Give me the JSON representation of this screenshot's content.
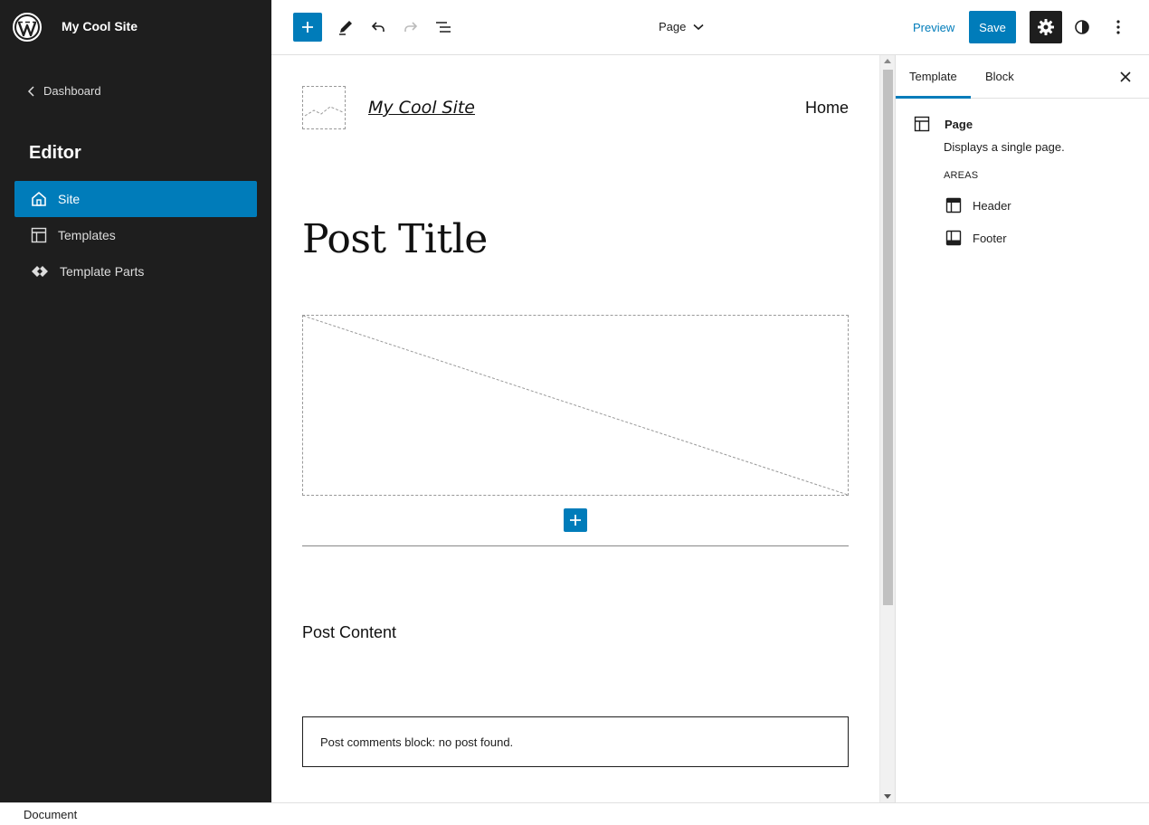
{
  "sidebar": {
    "site_name": "My Cool Site",
    "dashboard_label": "Dashboard",
    "heading": "Editor",
    "items": [
      {
        "label": "Site",
        "icon": "home-icon",
        "active": true
      },
      {
        "label": "Templates",
        "icon": "layout-icon",
        "active": false
      },
      {
        "label": "Template Parts",
        "icon": "symbol-icon",
        "active": false
      }
    ]
  },
  "toolbar": {
    "page_label": "Page",
    "preview_label": "Preview",
    "save_label": "Save"
  },
  "canvas": {
    "site_title": "My Cool Site",
    "nav_home": "Home",
    "post_title": "Post Title",
    "post_content": "Post Content",
    "comments_text": "Post comments block: no post found."
  },
  "panel": {
    "tabs": [
      "Template",
      "Block"
    ],
    "active_tab": "Template",
    "template_name": "Page",
    "template_desc": "Displays a single page.",
    "areas_label": "AREAS",
    "areas": [
      {
        "label": "Header",
        "icon": "header-icon"
      },
      {
        "label": "Footer",
        "icon": "footer-icon"
      }
    ]
  },
  "footer": {
    "label": "Document"
  },
  "colors": {
    "accent": "#007cba",
    "sidebar_bg": "#1e1e1e"
  }
}
